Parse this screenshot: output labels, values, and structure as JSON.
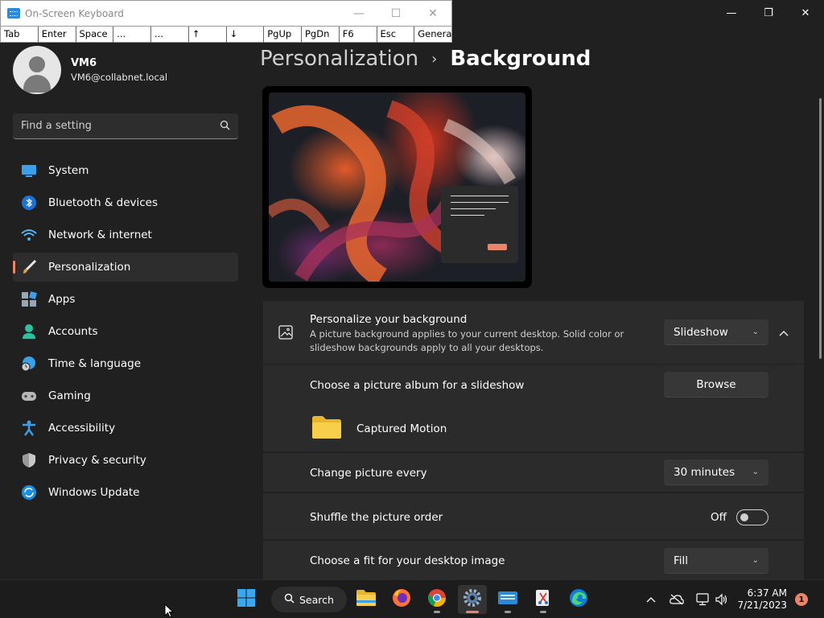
{
  "osk": {
    "title": "On-Screen Keyboard",
    "keys": [
      "Tab",
      "Enter",
      "Space",
      "...",
      "...",
      "↑",
      "↓",
      "PgUp",
      "PgDn",
      "F6",
      "Esc",
      "General"
    ]
  },
  "profile": {
    "name": "VM6",
    "email": "VM6@collabnet.local"
  },
  "search": {
    "placeholder": "Find a setting"
  },
  "nav": {
    "items": [
      {
        "label": "System"
      },
      {
        "label": "Bluetooth & devices"
      },
      {
        "label": "Network & internet"
      },
      {
        "label": "Personalization"
      },
      {
        "label": "Apps"
      },
      {
        "label": "Accounts"
      },
      {
        "label": "Time & language"
      },
      {
        "label": "Gaming"
      },
      {
        "label": "Accessibility"
      },
      {
        "label": "Privacy & security"
      },
      {
        "label": "Windows Update"
      }
    ]
  },
  "breadcrumb": {
    "parent": "Personalization",
    "separator": "›",
    "current": "Background"
  },
  "background": {
    "title": "Personalize your background",
    "description": "A picture background applies to your current desktop. Solid color or slideshow backgrounds apply to all your desktops.",
    "value": "Slideshow"
  },
  "album": {
    "label": "Choose a picture album for a slideshow",
    "button": "Browse",
    "folder": "Captured Motion"
  },
  "interval": {
    "label": "Change picture every",
    "value": "30 minutes"
  },
  "shuffle": {
    "label": "Shuffle the picture order",
    "state": "Off"
  },
  "fit": {
    "label": "Choose a fit for your desktop image",
    "value": "Fill"
  },
  "taskbar": {
    "search_label": "Search",
    "time": "6:37 AM",
    "date": "7/21/2023",
    "notifications": "1"
  },
  "colors": {
    "accent": "#e9856b",
    "background": "#202020",
    "card": "#2b2b2b"
  }
}
